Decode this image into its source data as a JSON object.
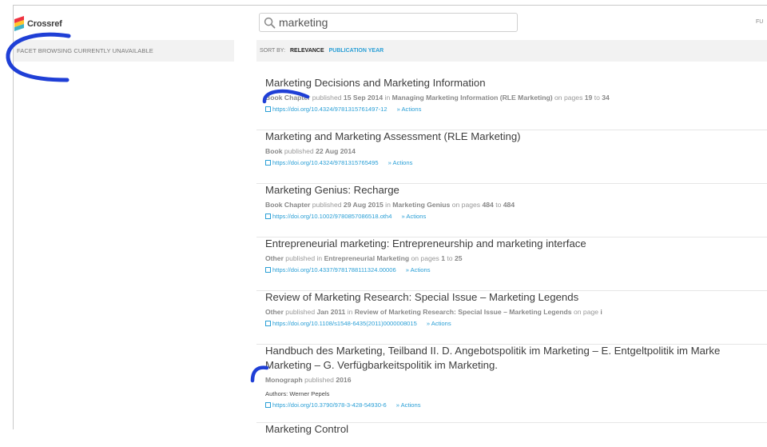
{
  "brand": {
    "name": "Crossref",
    "colors": [
      "#ef3340",
      "#ffc72c",
      "#3eb1c8"
    ]
  },
  "facets": {
    "notice": "FACET BROWSING CURRENTLY UNAVAILABLE"
  },
  "search": {
    "query": "marketing",
    "icon": "magnifier-icon"
  },
  "header_right": {
    "truncated_label": "FU"
  },
  "sort": {
    "label": "SORT BY:",
    "active": "RELEVANCE",
    "option": "PUBLICATION YEAR"
  },
  "accent_color": "#2a9fd6",
  "actions_label": "Actions",
  "results": [
    {
      "title": "Marketing Decisions and Marketing Information",
      "meta": [
        {
          "t": "Book Chapter",
          "b": true
        },
        {
          "t": " published "
        },
        {
          "t": "15 Sep 2014",
          "b": true
        },
        {
          "t": " in "
        },
        {
          "t": "Managing Marketing Information (RLE Marketing)",
          "b": true
        },
        {
          "t": " on pages "
        },
        {
          "t": "19",
          "b": true
        },
        {
          "t": " to "
        },
        {
          "t": "34",
          "b": true
        }
      ],
      "doi": "https://doi.org/10.4324/9781315761497-12"
    },
    {
      "title": "Marketing and Marketing Assessment (RLE Marketing)",
      "meta": [
        {
          "t": "Book",
          "b": true
        },
        {
          "t": " published "
        },
        {
          "t": "22 Aug 2014",
          "b": true
        }
      ],
      "doi": "https://doi.org/10.4324/9781315765495"
    },
    {
      "title": "Marketing Genius: Recharge",
      "meta": [
        {
          "t": "Book Chapter",
          "b": true
        },
        {
          "t": " published "
        },
        {
          "t": "29 Aug 2015",
          "b": true
        },
        {
          "t": " in "
        },
        {
          "t": "Marketing Genius",
          "b": true
        },
        {
          "t": " on pages "
        },
        {
          "t": "484",
          "b": true
        },
        {
          "t": " to "
        },
        {
          "t": "484",
          "b": true
        }
      ],
      "doi": "https://doi.org/10.1002/9780857086518.oth4"
    },
    {
      "title": "Entrepreneurial marketing: Entrepreneurship and marketing interface",
      "meta": [
        {
          "t": "Other",
          "b": true
        },
        {
          "t": " published in "
        },
        {
          "t": "Entrepreneurial Marketing",
          "b": true
        },
        {
          "t": " on pages "
        },
        {
          "t": "1",
          "b": true
        },
        {
          "t": " to "
        },
        {
          "t": "25",
          "b": true
        }
      ],
      "doi": "https://doi.org/10.4337/9781788111324.00006"
    },
    {
      "title": "Review of Marketing Research: Special Issue – Marketing Legends",
      "meta": [
        {
          "t": "Other",
          "b": true
        },
        {
          "t": " published "
        },
        {
          "t": "Jan 2011",
          "b": true
        },
        {
          "t": " in "
        },
        {
          "t": "Review of Marketing Research: Special Issue – Marketing Legends",
          "b": true
        },
        {
          "t": " on page "
        },
        {
          "t": "i",
          "b": true
        }
      ],
      "doi": "https://doi.org/10.1108/s1548-6435(2011)0000008015"
    },
    {
      "title_lines": [
        "Handbuch des Marketing, Teilband II. D. Angebotspolitik im Marketing – E. Entgeltpolitik im Marke",
        "Marketing – G. Verfügbarkeitspolitik im Marketing."
      ],
      "meta": [
        {
          "t": "Monograph",
          "b": true
        },
        {
          "t": " published "
        },
        {
          "t": "2016",
          "b": true
        }
      ],
      "authors": "Authors: Werner Pepels",
      "doi": "https://doi.org/10.3790/978-3-428-54930-6"
    },
    {
      "title": "Marketing Control"
    }
  ]
}
